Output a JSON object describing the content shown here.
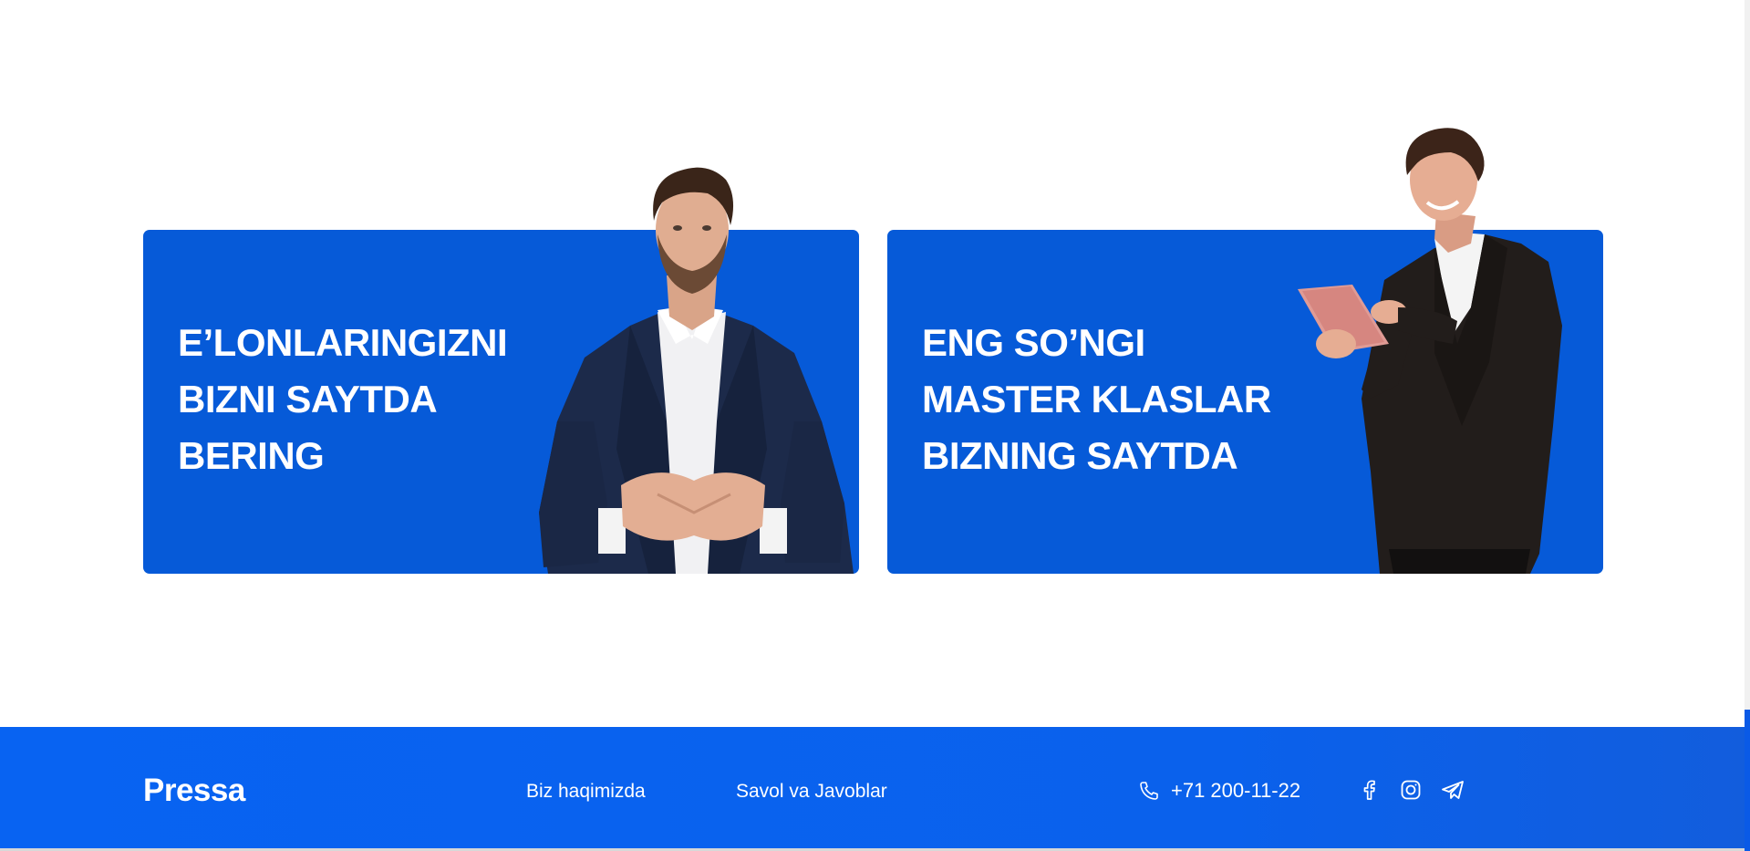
{
  "banners": [
    {
      "title_lines": [
        "E’LONLARINGIZNI",
        "BIZNI SAYTDA",
        "BERING"
      ],
      "person_image": "businessman-clasped-hands-photo"
    },
    {
      "title_lines": [
        "ENG SO’NGI",
        "MASTER KLASLAR",
        "BIZNING SAYTDA"
      ],
      "person_image": "businessman-with-tablet-photo"
    }
  ],
  "footer": {
    "logo": "Pressa",
    "links": [
      "Biz haqimizda",
      "Savol va Javoblar"
    ],
    "phone": "+71 200-11-22",
    "phone_icon": "phone-icon",
    "socials": [
      "facebook-icon",
      "instagram-icon",
      "telegram-icon"
    ]
  },
  "colors": {
    "banner_bg": "#065ad8",
    "footer_bg": "#0863f2",
    "text": "#ffffff"
  }
}
